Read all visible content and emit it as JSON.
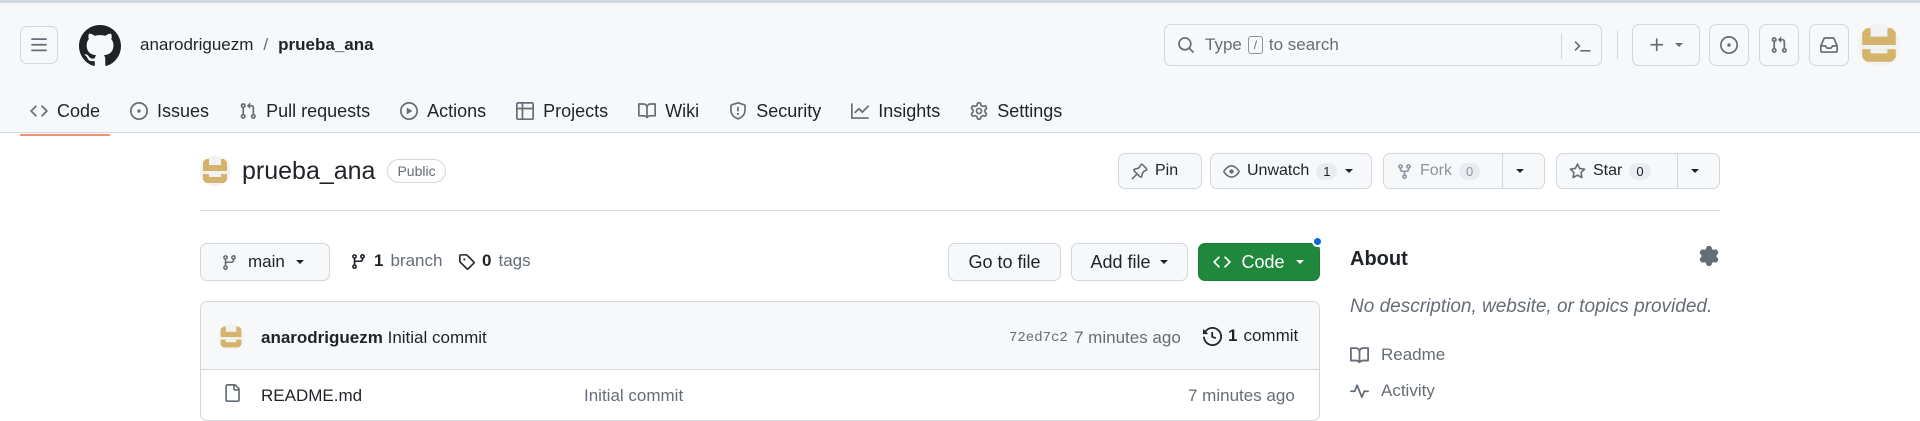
{
  "header": {
    "owner": "anarodriguezm",
    "separator": "/",
    "repo": "prueba_ana",
    "search": {
      "pre": "Type",
      "key": "/",
      "post": "to search"
    }
  },
  "nav_tabs": [
    {
      "label": "Code",
      "icon": "code-icon",
      "active": true
    },
    {
      "label": "Issues",
      "icon": "issue-icon"
    },
    {
      "label": "Pull requests",
      "icon": "pull-request-icon"
    },
    {
      "label": "Actions",
      "icon": "play-icon"
    },
    {
      "label": "Projects",
      "icon": "table-icon"
    },
    {
      "label": "Wiki",
      "icon": "book-icon"
    },
    {
      "label": "Security",
      "icon": "shield-icon"
    },
    {
      "label": "Insights",
      "icon": "graph-icon"
    },
    {
      "label": "Settings",
      "icon": "gear-icon"
    }
  ],
  "repo": {
    "title": "prueba_ana",
    "visibility": "Public",
    "actions": {
      "pin": "Pin",
      "unwatch": "Unwatch",
      "watch_count": "1",
      "fork": "Fork",
      "fork_count": "0",
      "star": "Star",
      "star_count": "0"
    }
  },
  "toolbar": {
    "branch": "main",
    "branch_count": "1",
    "branch_label": "branch",
    "tag_count": "0",
    "tag_label": "tags",
    "go_to_file": "Go to file",
    "add_file": "Add file",
    "code": "Code"
  },
  "latest_commit": {
    "author": "anarodriguezm",
    "message": "Initial commit",
    "sha": "72ed7c2",
    "time": "7 minutes ago",
    "count": "1",
    "count_label": "commit"
  },
  "files": [
    {
      "name": "README.md",
      "commit": "Initial commit",
      "time": "7 minutes ago",
      "icon": "file-icon"
    }
  ],
  "about": {
    "title": "About",
    "description": "No description, website, or topics provided.",
    "links": [
      {
        "label": "Readme",
        "icon": "book-icon"
      },
      {
        "label": "Activity",
        "icon": "pulse-icon"
      }
    ]
  },
  "colors": {
    "primary_button": "#1f883d",
    "active_tab_underline": "#fd8c73",
    "notification_dot": "#0969da"
  }
}
